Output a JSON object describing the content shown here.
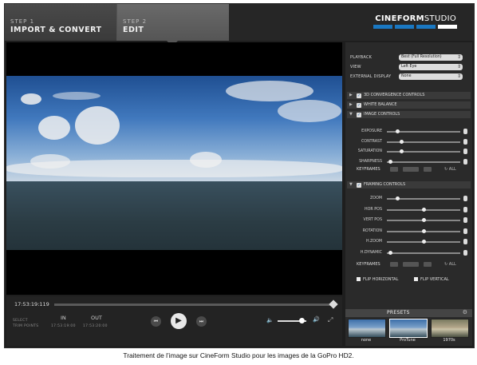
{
  "steps": [
    {
      "label": "STEP 1",
      "title": "IMPORT & CONVERT"
    },
    {
      "label": "STEP 2",
      "title": "EDIT"
    }
  ],
  "brand": {
    "bold": "CINEFORM",
    "light": "STUDIO",
    "bar_colors": [
      "#1a78c2",
      "#1a78c2",
      "#1a78c2",
      "#ffffff"
    ]
  },
  "playback_settings": [
    {
      "label": "PLAYBACK",
      "value": "Best (Full Resolution)"
    },
    {
      "label": "VIEW",
      "value": "Left Eye"
    },
    {
      "label": "EXTERNAL DISPLAY",
      "value": "None"
    }
  ],
  "sections": {
    "convergence": "3D CONVERGENCE CONTROLS",
    "white_balance": "WHITE BALANCE",
    "image_controls": "IMAGE CONTROLS",
    "framing_controls": "FRAMING CONTROLS"
  },
  "image_sliders": [
    {
      "label": "EXPOSURE",
      "value": 0.15
    },
    {
      "label": "CONTRAST",
      "value": 0.2
    },
    {
      "label": "SATURATION",
      "value": 0.2
    },
    {
      "label": "SHARPNESS",
      "value": 0.05
    }
  ],
  "framing_sliders": [
    {
      "label": "ZOOM",
      "value": 0.15
    },
    {
      "label": "HOR POS",
      "value": 0.5
    },
    {
      "label": "VERT POS",
      "value": 0.5
    },
    {
      "label": "ROTATION",
      "value": 0.5
    },
    {
      "label": "H.ZOOM",
      "value": 0.5
    },
    {
      "label": "H.DYNAMIC",
      "value": 0.05
    }
  ],
  "keyframes": {
    "label": "KEYFRAMES",
    "all": "ALL"
  },
  "flip": {
    "horizontal": "FLIP HORIZONTAL",
    "vertical": "FLIP VERTICAL"
  },
  "presets": {
    "title": "PRESETS",
    "items": [
      "none",
      "ProTune",
      "1970s"
    ]
  },
  "timeline": {
    "timecode": "17:53:19:119",
    "select_label": "SELECT",
    "trim_label": "TRIM POINTS",
    "in_label": "IN",
    "out_label": "OUT",
    "in_time": "17:53:19:00",
    "out_time": "17:53:20:00",
    "progress": 1.0,
    "volume": 0.85
  },
  "caption": "Traitement de l’image sur CineForm Studio pour les images de la GoPro HD2."
}
